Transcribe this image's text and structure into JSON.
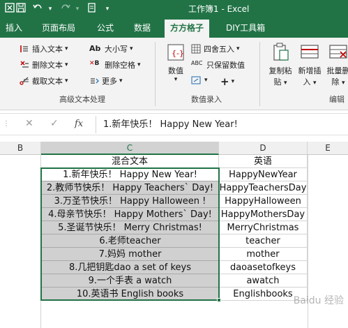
{
  "window": {
    "title": "工作簿1  -  Excel"
  },
  "ribbon_tabs": [
    "插入",
    "页面布局",
    "公式",
    "数据",
    "方方格子",
    "DIY工具箱"
  ],
  "active_tab": "方方格子",
  "ribbon": {
    "text_group": {
      "insert_text": "插入文本",
      "delete_text": "删除文本",
      "extract_text": "截取文本",
      "case": "大小写",
      "delete_spaces": "删除空格",
      "more": "更多",
      "label": "高级文本处理"
    },
    "number_group": {
      "value": "数值",
      "round": "四舍五入",
      "keep_value": "只保留数值",
      "label": "数值录入"
    },
    "edit_group": {
      "copy_paste": [
        "复制粘",
        "贴"
      ],
      "insert_new": [
        "新增插",
        "入"
      ],
      "batch_delete": [
        "批量删",
        "除"
      ],
      "label": "编辑"
    }
  },
  "formula_bar": {
    "cancel": "✕",
    "confirm": "✓",
    "fx": "fx",
    "content": "1.新年快乐！ Happy New Year!"
  },
  "columns": [
    "B",
    "C",
    "D",
    "E"
  ],
  "selected_column": "C",
  "headers": {
    "C": "混合文本",
    "D": "英语"
  },
  "rows": [
    {
      "mixed": "1.新年快乐！ Happy New Year!",
      "english": "HappyNewYear"
    },
    {
      "mixed": "2.教师节快乐！ Happy Teachers` Day!",
      "english": "HappyTeachersDay"
    },
    {
      "mixed": "3.万圣节快乐！ Happy Halloween !",
      "english": "HappyHalloween"
    },
    {
      "mixed": "4.母亲节快乐！ Happy Mothers` Day!",
      "english": "HappyMothersDay"
    },
    {
      "mixed": "5.圣诞节快乐！ Merry Christmas!",
      "english": "MerryChristmas"
    },
    {
      "mixed": "6.老师teacher",
      "english": "teacher"
    },
    {
      "mixed": "7.妈妈 mother",
      "english": "mother"
    },
    {
      "mixed": "8.几把钥匙dao a set of keys",
      "english": "daoasetofkeys"
    },
    {
      "mixed": "9.一个手表 a watch",
      "english": "awatch"
    },
    {
      "mixed": "10.英语书 English books",
      "english": "Englishbooks"
    }
  ],
  "watermark": "Baidu 经验",
  "colors": {
    "excel_green": "#217346",
    "selection_fill": "#d0d0d0"
  }
}
